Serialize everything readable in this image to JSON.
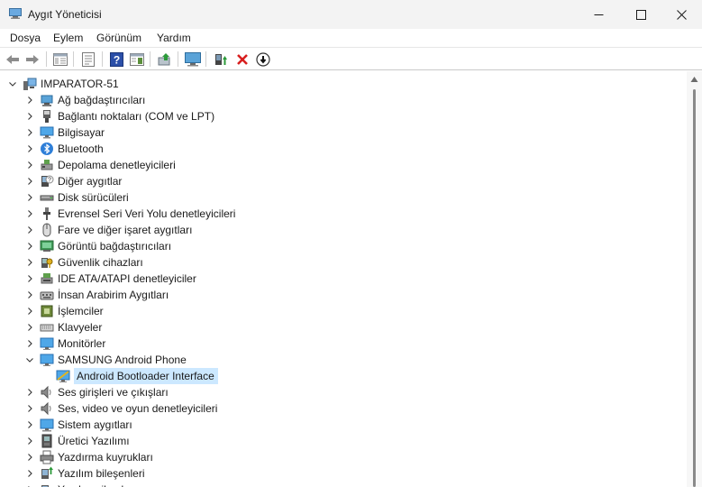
{
  "window": {
    "title": "Aygıt Yöneticisi"
  },
  "menu": {
    "items": [
      "Dosya",
      "Eylem",
      "Görünüm",
      "Yardım"
    ]
  },
  "tree": {
    "root": "IMPARATOR-51",
    "items": [
      {
        "label": "Ağ bağdaştırıcıları",
        "icon": "network-adapter-icon"
      },
      {
        "label": "Bağlantı noktaları (COM ve LPT)",
        "icon": "port-icon"
      },
      {
        "label": "Bilgisayar",
        "icon": "computer-icon"
      },
      {
        "label": "Bluetooth",
        "icon": "bluetooth-icon"
      },
      {
        "label": "Depolama denetleyicileri",
        "icon": "storage-controller-icon"
      },
      {
        "label": "Diğer aygıtlar",
        "icon": "unknown-device-icon"
      },
      {
        "label": "Disk sürücüleri",
        "icon": "disk-drive-icon"
      },
      {
        "label": "Evrensel Seri Veri Yolu denetleyicileri",
        "icon": "usb-icon"
      },
      {
        "label": "Fare ve diğer işaret aygıtları",
        "icon": "mouse-icon"
      },
      {
        "label": "Görüntü bağdaştırıcıları",
        "icon": "display-adapter-icon"
      },
      {
        "label": "Güvenlik cihazları",
        "icon": "security-device-icon"
      },
      {
        "label": "IDE ATA/ATAPI denetleyiciler",
        "icon": "ide-controller-icon"
      },
      {
        "label": "İnsan Arabirim Aygıtları",
        "icon": "hid-icon"
      },
      {
        "label": "İşlemciler",
        "icon": "processor-icon"
      },
      {
        "label": "Klavyeler",
        "icon": "keyboard-icon"
      },
      {
        "label": "Monitörler",
        "icon": "monitor-icon"
      },
      {
        "label": "SAMSUNG Android Phone",
        "icon": "android-phone-icon",
        "expanded": true
      },
      {
        "label": "Android Bootloader Interface",
        "icon": "bootloader-interface-icon",
        "child": true,
        "selected": true
      },
      {
        "label": "Ses girişleri ve çıkışları",
        "icon": "speaker-icon"
      },
      {
        "label": "Ses, video ve oyun denetleyicileri",
        "icon": "speaker-icon"
      },
      {
        "label": "Sistem aygıtları",
        "icon": "system-device-icon"
      },
      {
        "label": "Üretici Yazılımı",
        "icon": "firmware-icon"
      },
      {
        "label": "Yazdırma kuyrukları",
        "icon": "printer-icon"
      },
      {
        "label": "Yazılım bileşenleri",
        "icon": "software-component-icon"
      },
      {
        "label": "Yazılım cihazları",
        "icon": "software-device-icon"
      }
    ]
  },
  "colors": {
    "selection": "#cce8ff",
    "titlebar": "#f3f3f3",
    "accent": "#2a6fcb",
    "remove": "#d81e1e"
  }
}
